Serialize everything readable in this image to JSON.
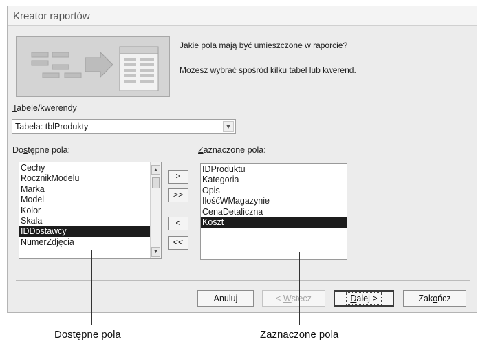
{
  "window": {
    "title": "Kreator raportów"
  },
  "intro": {
    "question": "Jakie pola mają być umieszczone w raporcie?",
    "hint": "Możesz wybrać spośród kilku tabel lub kwerend."
  },
  "tables_queries": {
    "label_underlined": "T",
    "label_rest": "abele/kwerendy",
    "selected": "Tabela: tblProdukty"
  },
  "available": {
    "label_pre": "Do",
    "label_underlined": "s",
    "label_post": "tępne pola:",
    "items": [
      "Cechy",
      "RocznikModelu",
      "Marka",
      "Model",
      "Kolor",
      "Skala",
      "IDDostawcy",
      "NumerZdjęcia"
    ],
    "selected_index": 6
  },
  "selected": {
    "label_underlined": "Z",
    "label_rest": "aznaczone pola:",
    "items": [
      "IDProduktu",
      "Kategoria",
      "Opis",
      "IlośćWMagazynie",
      "CenaDetaliczna",
      "Koszt"
    ],
    "selected_index": 5
  },
  "move_buttons": {
    "add_one": ">",
    "add_all": ">>",
    "remove_one": "<",
    "remove_all": "<<"
  },
  "buttons": {
    "cancel": "Anuluj",
    "back_pre": "< ",
    "back_underlined": "W",
    "back_post": "stecz",
    "next_underlined": "D",
    "next_post": "alej >",
    "finish_pre": "Zak",
    "finish_underlined": "o",
    "finish_post": "ńcz"
  },
  "callouts": {
    "available_fields": "Dostępne pola",
    "selected_fields": "Zaznaczone pola"
  }
}
